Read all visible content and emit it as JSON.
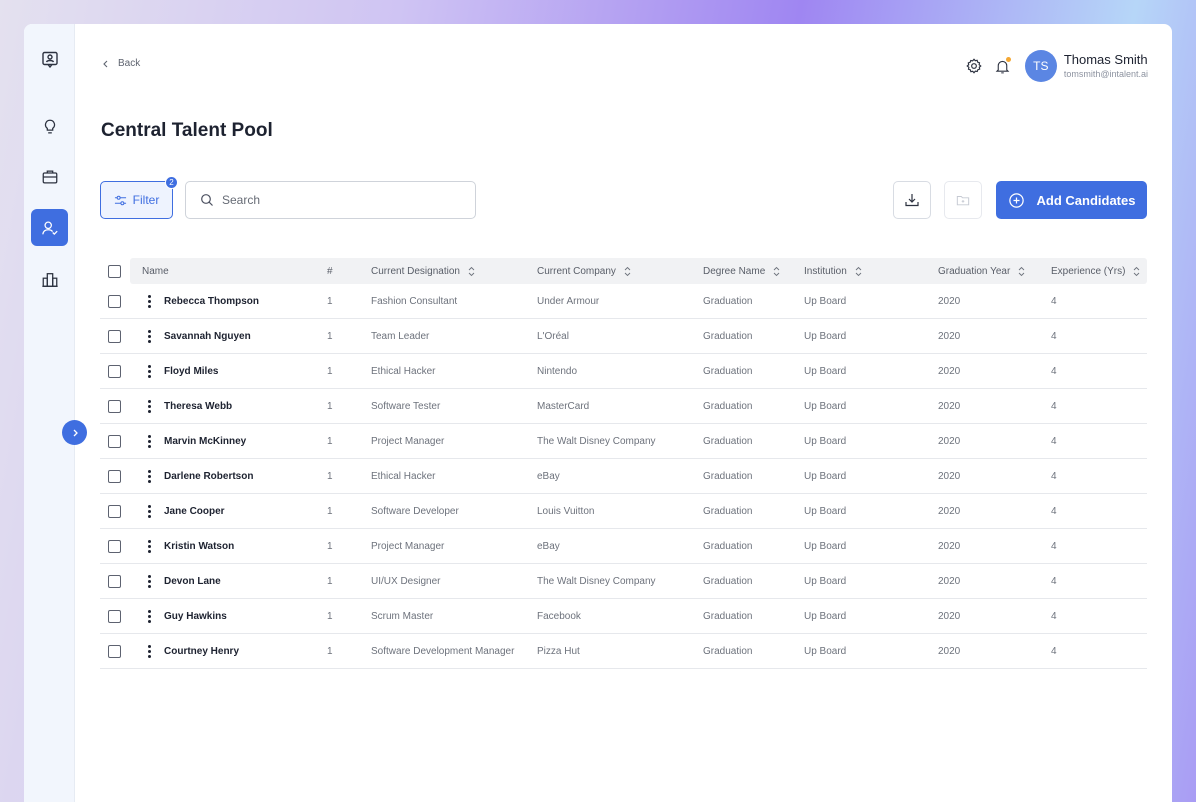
{
  "header": {
    "back_label": "Back",
    "page_title": "Central Talent Pool",
    "user": {
      "initials": "TS",
      "name": "Thomas Smith",
      "email": "tomsmith@intalent.ai"
    }
  },
  "sidebar": {
    "items": [
      {
        "icon": "profile-chat-icon"
      },
      {
        "icon": "lightbulb-icon"
      },
      {
        "icon": "briefcase-icon"
      },
      {
        "icon": "user-check-icon",
        "active": true
      },
      {
        "icon": "org-chart-icon"
      }
    ]
  },
  "toolbar": {
    "filter_label": "Filter",
    "filter_count": "2",
    "search_placeholder": "Search",
    "add_label": "Add Candidates"
  },
  "colors": {
    "accent": "#3f6ee0",
    "notification": "#f4a733"
  },
  "table": {
    "columns": [
      "Name",
      "#",
      "Current Designation",
      "Current Company",
      "Degree Name",
      "Institution",
      "Graduation Year",
      "Experience (Yrs)"
    ],
    "rows": [
      {
        "name": "Rebecca Thompson",
        "num": "1",
        "designation": "Fashion Consultant",
        "company": "Under Armour",
        "degree": "Graduation",
        "institution": "Up Board",
        "year": "2020",
        "exp": "4"
      },
      {
        "name": "Savannah Nguyen",
        "num": "1",
        "designation": "Team Leader",
        "company": "L'Oréal",
        "degree": "Graduation",
        "institution": "Up Board",
        "year": "2020",
        "exp": "4"
      },
      {
        "name": "Floyd Miles",
        "num": "1",
        "designation": "Ethical Hacker",
        "company": "Nintendo",
        "degree": "Graduation",
        "institution": "Up Board",
        "year": "2020",
        "exp": "4"
      },
      {
        "name": "Theresa Webb",
        "num": "1",
        "designation": "Software Tester",
        "company": "MasterCard",
        "degree": "Graduation",
        "institution": "Up Board",
        "year": "2020",
        "exp": "4"
      },
      {
        "name": "Marvin McKinney",
        "num": "1",
        "designation": "Project Manager",
        "company": "The Walt Disney Company",
        "degree": "Graduation",
        "institution": "Up Board",
        "year": "2020",
        "exp": "4"
      },
      {
        "name": "Darlene Robertson",
        "num": "1",
        "designation": "Ethical Hacker",
        "company": "eBay",
        "degree": "Graduation",
        "institution": "Up Board",
        "year": "2020",
        "exp": "4"
      },
      {
        "name": "Jane Cooper",
        "num": "1",
        "designation": "Software Developer",
        "company": "Louis Vuitton",
        "degree": "Graduation",
        "institution": "Up Board",
        "year": "2020",
        "exp": "4"
      },
      {
        "name": "Kristin Watson",
        "num": "1",
        "designation": "Project Manager",
        "company": "eBay",
        "degree": "Graduation",
        "institution": "Up Board",
        "year": "2020",
        "exp": "4"
      },
      {
        "name": "Devon Lane",
        "num": "1",
        "designation": "UI/UX Designer",
        "company": "The Walt Disney Company",
        "degree": "Graduation",
        "institution": "Up Board",
        "year": "2020",
        "exp": "4"
      },
      {
        "name": "Guy Hawkins",
        "num": "1",
        "designation": "Scrum Master",
        "company": "Facebook",
        "degree": "Graduation",
        "institution": "Up Board",
        "year": "2020",
        "exp": "4"
      },
      {
        "name": "Courtney Henry",
        "num": "1",
        "designation": "Software Development Manager",
        "company": "Pizza Hut",
        "degree": "Graduation",
        "institution": "Up Board",
        "year": "2020",
        "exp": "4"
      }
    ]
  }
}
